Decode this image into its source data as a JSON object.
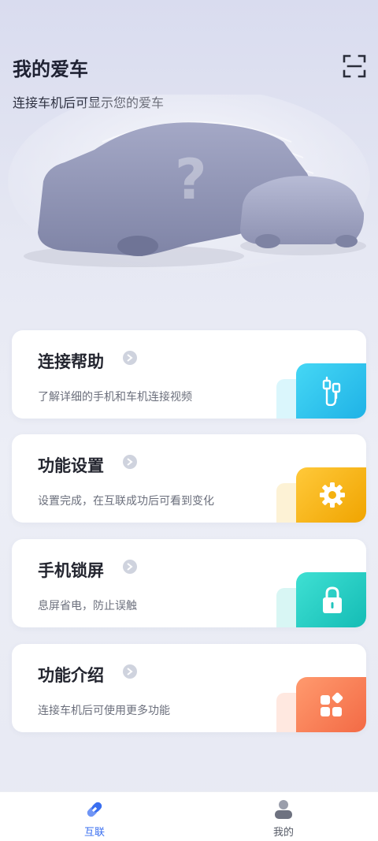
{
  "header": {
    "title": "我的爱车",
    "subtitle": "连接车机后可显示您的爱车"
  },
  "cards": [
    {
      "title": "连接帮助",
      "desc": "了解详细的手机和车机连接视频",
      "icon": "usb-cable-icon",
      "color": "#33c8ee"
    },
    {
      "title": "功能设置",
      "desc": "设置完成，在互联成功后可看到变化",
      "icon": "gear-icon",
      "color": "#f2b51c"
    },
    {
      "title": "手机锁屏",
      "desc": "息屏省电，防止误触",
      "icon": "lock-icon",
      "color": "#2fd3c9"
    },
    {
      "title": "功能介绍",
      "desc": "连接车机后可使用更多功能",
      "icon": "apps-icon",
      "color": "#ff7a55"
    }
  ],
  "tabbar": {
    "items": [
      {
        "label": "互联",
        "icon": "link-icon",
        "active": true
      },
      {
        "label": "我的",
        "icon": "user-icon",
        "active": false
      }
    ],
    "active_color": "#3a6ff0",
    "inactive_color": "#555a66"
  }
}
